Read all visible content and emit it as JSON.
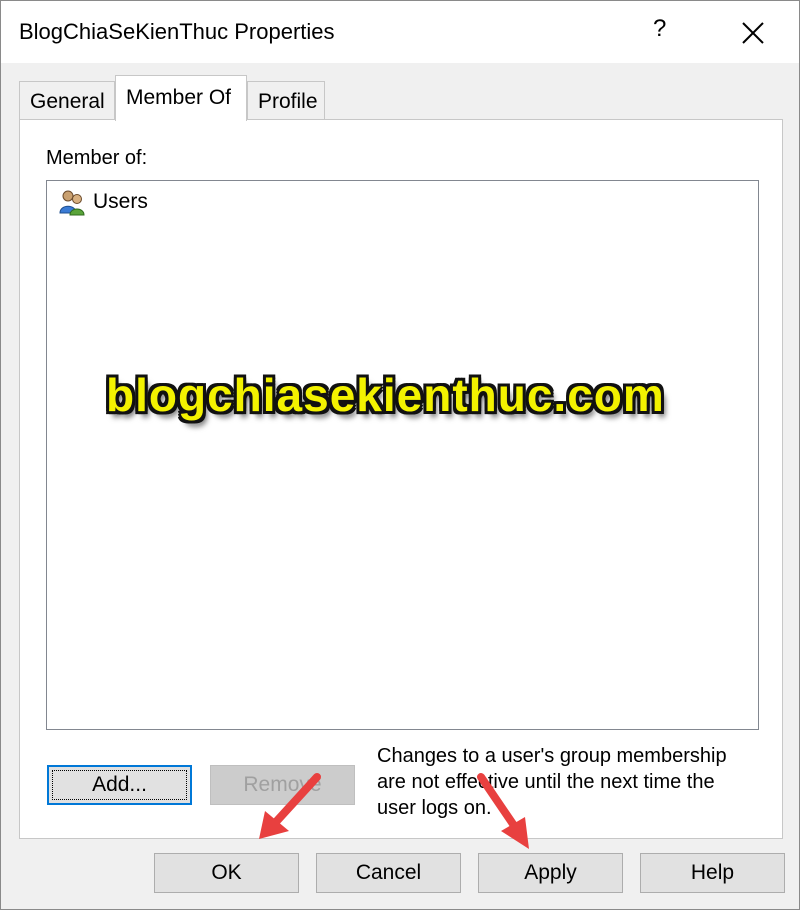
{
  "window": {
    "title": "BlogChiaSeKienThuc Properties",
    "help_glyph": "?",
    "close_icon": "close-icon"
  },
  "tabs": [
    {
      "label": "General",
      "active": false
    },
    {
      "label": "Member Of",
      "active": true
    },
    {
      "label": "Profile",
      "active": false
    }
  ],
  "member_of": {
    "label": "Member of:",
    "items": [
      {
        "label": "Users",
        "icon": "user-group-icon"
      }
    ]
  },
  "watermark": "blogchiasekienthuc.com",
  "buttons": {
    "add": "Add...",
    "remove": "Remove",
    "ok": "OK",
    "cancel": "Cancel",
    "apply": "Apply",
    "help": "Help"
  },
  "note": "Changes to a user's group membership are not effective until the next time the user logs on.",
  "colors": {
    "arrow": "#e8403f",
    "focus": "#0078d7",
    "watermark": "#f3f200"
  }
}
